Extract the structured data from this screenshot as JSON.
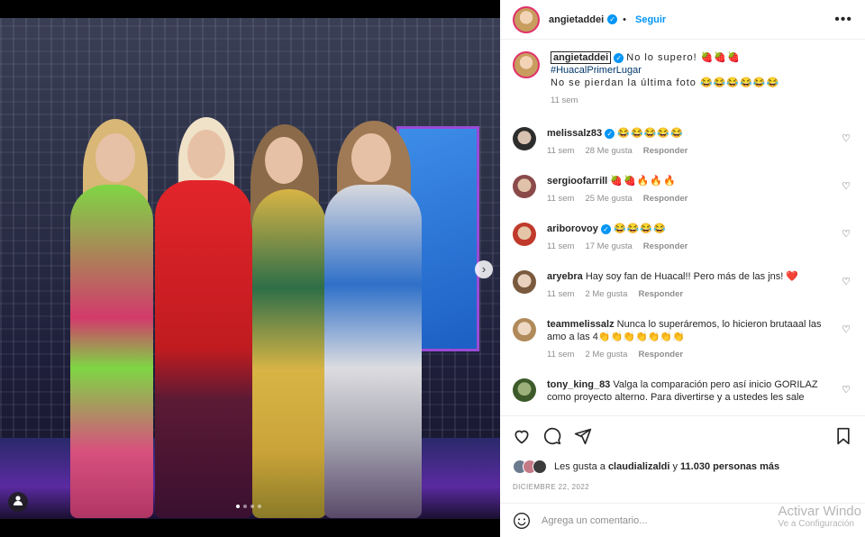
{
  "post": {
    "photo": {
      "carousel_dots": 4,
      "active_dot": 0,
      "next_label": "›"
    }
  },
  "header": {
    "username": "angietaddei",
    "follow_label": "Seguir",
    "more_label": "•••"
  },
  "caption": {
    "username": "angietaddei",
    "line1": "No lo supero! 🍓🍓🍓",
    "hashtag": "#HuacalPrimerLugar",
    "line3": "No se pierdan la última foto 😂😂😂😂😂😂",
    "time": "11 sem"
  },
  "comments": [
    {
      "username": "melissalz83",
      "verified": true,
      "text": "😂😂😂😂😂",
      "time": "11 sem",
      "likes": "28 Me gusta",
      "reply": "Responder"
    },
    {
      "username": "sergioofarrill",
      "verified": false,
      "text": "🍓🍓🔥🔥🔥",
      "time": "11 sem",
      "likes": "25 Me gusta",
      "reply": "Responder"
    },
    {
      "username": "ariborovoy",
      "verified": true,
      "text": "😂😂😂😂",
      "time": "11 sem",
      "likes": "17 Me gusta",
      "reply": "Responder"
    },
    {
      "username": "aryebra",
      "verified": false,
      "text": "Hay soy fan de Huacal!! Pero más de las jns! ❤️",
      "time": "11 sem",
      "likes": "2 Me gusta",
      "reply": "Responder"
    },
    {
      "username": "teammelissalz",
      "verified": false,
      "text": "Nunca lo superáremos, lo hicieron brutaaal las amo a las 4👏👏👏👏👏👏👏",
      "time": "11 sem",
      "likes": "2 Me gusta",
      "reply": "Responder"
    },
    {
      "username": "tony_king_83",
      "verified": false,
      "text": "Valga la comparación pero así inicio GORILAZ como proyecto alterno. Para divertirse y a ustedes les sale",
      "time": "",
      "likes": "",
      "reply": ""
    }
  ],
  "likes": {
    "prefix": "Les gusta a",
    "user": "claudializaldi",
    "middle": "y",
    "count": "11.030 personas más"
  },
  "date": "DICIEMBRE 22, 2022",
  "add_comment": {
    "placeholder": "Agrega un comentario..."
  },
  "watermark": {
    "line1": "Activar Windo",
    "line2": "Ve a Configuración"
  },
  "colors": {
    "accent": "#0095f6",
    "like_heart": "#ed4956",
    "muted": "#8e8e8e"
  }
}
